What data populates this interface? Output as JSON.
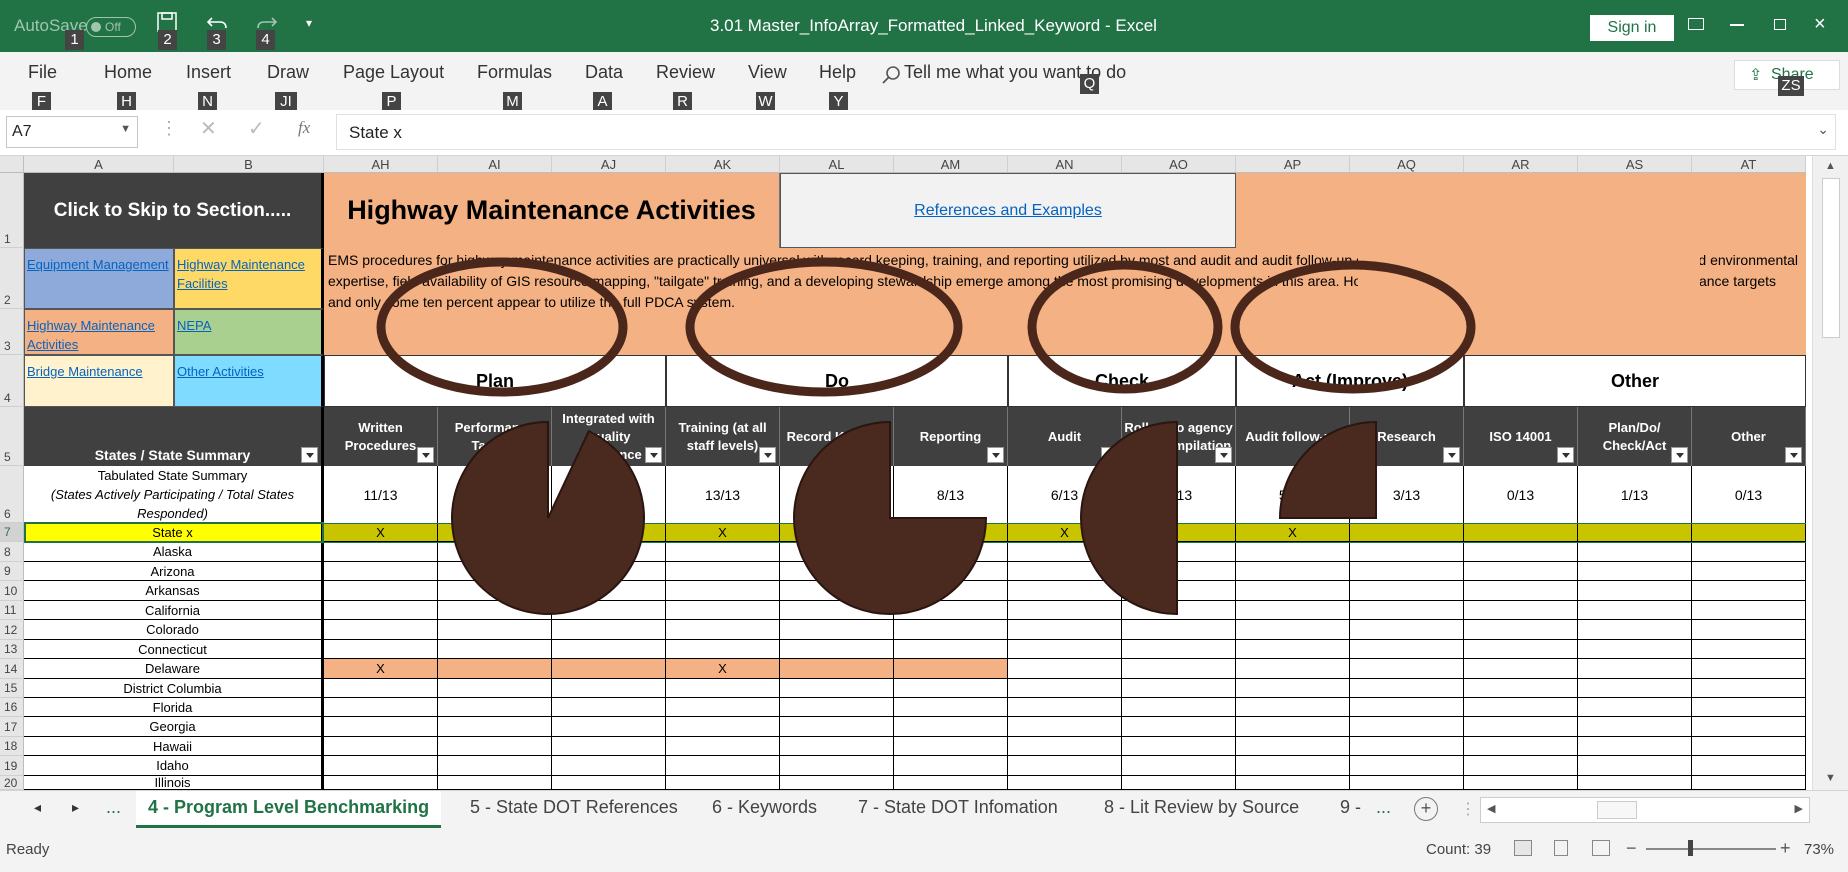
{
  "titlebar": {
    "autosave": "AutoSave",
    "toggle": "Off",
    "doc_title": "3.01 Master_InfoArray_Formatted_Linked_Keyword  -  Excel",
    "sign_in": "Sign in",
    "keytips": [
      "1",
      "2",
      "3",
      "4"
    ]
  },
  "ribbon": {
    "tabs": [
      {
        "label": "File",
        "key": "F"
      },
      {
        "label": "Home",
        "key": "H"
      },
      {
        "label": "Insert",
        "key": "N"
      },
      {
        "label": "Draw",
        "key": "JI"
      },
      {
        "label": "Page Layout",
        "key": "P"
      },
      {
        "label": "Formulas",
        "key": "M"
      },
      {
        "label": "Data",
        "key": "A"
      },
      {
        "label": "Review",
        "key": "R"
      },
      {
        "label": "View",
        "key": "W"
      },
      {
        "label": "Help",
        "key": "Y"
      }
    ],
    "tell_me": "Tell me what you want to do",
    "tell_me_key": "Q",
    "share": "Share",
    "share_key": "ZS"
  },
  "formula_bar": {
    "name_box": "A7",
    "fx": "fx",
    "value": "State x"
  },
  "columns": [
    "A",
    "B",
    "AH",
    "AI",
    "AJ",
    "AK",
    "AL",
    "AM",
    "AN",
    "AO",
    "AP",
    "AQ",
    "AR",
    "AS",
    "AT"
  ],
  "rows": [
    "1",
    "2",
    "3",
    "4",
    "5",
    "6",
    "7",
    "8",
    "9",
    "10",
    "11",
    "12",
    "13",
    "14",
    "15",
    "16",
    "17",
    "18",
    "19",
    "20"
  ],
  "sheet": {
    "skip_header": "Click to Skip to Section.....",
    "title": "Highway Maintenance Activities",
    "references": "References and Examples",
    "description": "EMS procedures for highway maintenance activities are practically universal with  record keeping, training,  and reporting utilized by most and audit and audit follow-up employed by almost a third of those reporting. Imbedded environmental expertise, field availability of GIS resource mapping, \"tailgate\" training, and a developing stewardship emerge among the most promising developments in this area.  However, less than a third of DOTs seem to have performance targets and only some ten percent appear to utilize the full PDCA system.",
    "nav": [
      {
        "label": "Equipment Management",
        "color": "#8eaadb"
      },
      {
        "label": "Highway Maintenance Facilities",
        "color": "#ffd966"
      },
      {
        "label": "Highway Maintenance Activities",
        "color": "#f4b183"
      },
      {
        "label": "NEPA",
        "color": "#a9d08e"
      },
      {
        "label": "Bridge Maintenance",
        "color": "#fff2cc"
      },
      {
        "label": "Other Activities",
        "color": "#7fdbff"
      }
    ],
    "groups": [
      "Plan",
      "Do",
      "Check",
      "Act (Improve)",
      "Other"
    ],
    "states_header": "States / State Summary",
    "tab_summary_1": "Tabulated State Summary",
    "tab_summary_2": "(States Actively Participating / Total States Responded)",
    "col_headers": [
      "Written Procedures",
      "Performance Targets",
      "Integrated with Quality Assurance",
      "Training (at all staff levels)",
      "Record Keeping",
      "Reporting",
      "Audit",
      "Roll up to agency wide compilation",
      "Audit follow-up",
      "Research",
      "ISO 14001",
      "Plan/Do/ Check/Act",
      "Other"
    ],
    "summary": [
      "11/13",
      "5/13",
      "6/13",
      "13/13",
      "11/13",
      "8/13",
      "6/13",
      "5/13",
      "5/13",
      "3/13",
      "0/13",
      "1/13",
      "0/13"
    ],
    "states": [
      "State x",
      "Alaska",
      "Arizona",
      "Arkansas",
      "California",
      "Colorado",
      "Connecticut",
      "Delaware",
      "District Columbia",
      "Florida",
      "Georgia",
      "Hawaii",
      "Idaho",
      "Illinois"
    ],
    "marks": {
      "state_x": [
        "X",
        "",
        "",
        "X",
        "",
        "X",
        "X",
        "",
        "X",
        "",
        "",
        "",
        ""
      ],
      "delaware": [
        "X",
        "",
        "",
        "X",
        "",
        "",
        "",
        "",
        "",
        "",
        "",
        "",
        ""
      ]
    }
  },
  "sheet_tabs": [
    "4 - Program Level Benchmarking",
    "5 - State DOT References",
    "6 - Keywords",
    "7 - State DOT Infomation",
    "8 - Lit Review by Source",
    "9 - "
  ],
  "sheet_ellipsis": "...",
  "status": {
    "ready": "Ready",
    "count": "Count: 39",
    "zoom": "73%"
  },
  "overlay": {
    "circle_color": "#4a261b",
    "pie_color": "#4a2a1f",
    "pies": [
      {
        "fraction": 0.93
      },
      {
        "fraction": 0.75
      },
      {
        "fraction": 0.5
      },
      {
        "fraction": 0.25
      }
    ]
  },
  "colors": {
    "excel_green": "#217346",
    "header_dark": "#404040",
    "salmon": "#f4b183",
    "highlight_yellow": "#ffff00",
    "row_highlight": "#c9c400"
  }
}
